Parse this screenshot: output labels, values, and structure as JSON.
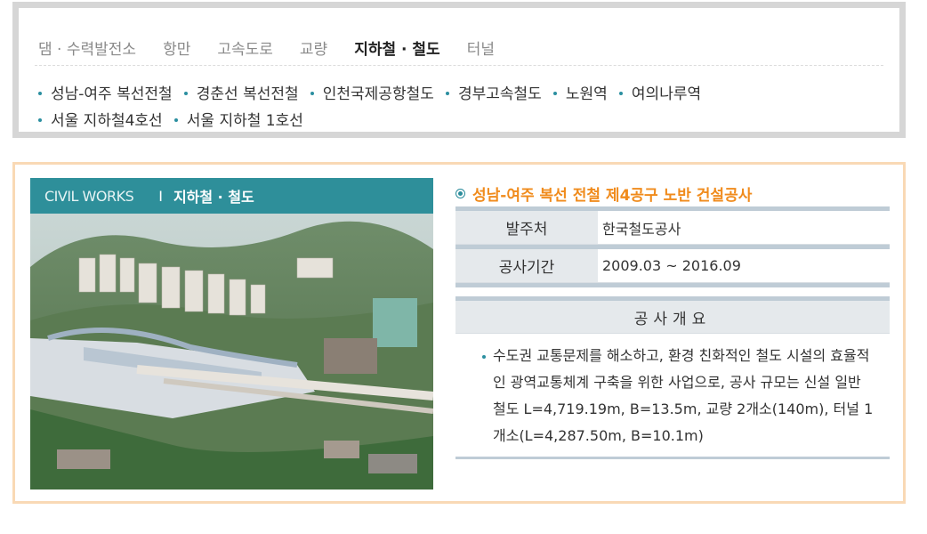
{
  "categories": {
    "tabs": [
      {
        "label": "댐 · 수력발전소",
        "active": false
      },
      {
        "label": "항만",
        "active": false
      },
      {
        "label": "고속도로",
        "active": false
      },
      {
        "label": "교량",
        "active": false
      },
      {
        "label": "지하철 · 철도",
        "active": true
      },
      {
        "label": "터널",
        "active": false
      }
    ],
    "items": [
      "성남-여주 복선전철",
      "경춘선 복선전철",
      "인천국제공항철도",
      "경부고속철도",
      "노원역",
      "여의나루역",
      "서울 지하철4호선",
      "서울 지하철 1호선"
    ]
  },
  "project": {
    "header_brand": "CIVIL WORKS",
    "header_sep": "I",
    "header_category": "지하철 · 철도",
    "title": "성남-여주 복선 전철 제4공구 노반 건설공사",
    "client_label": "발주처",
    "client_value": "한국철도공사",
    "period_label": "공사기간",
    "period_value": "2009.03 ~ 2016.09",
    "summary_label": "공사개요",
    "summary_text": "수도권 교통문제를 해소하고, 환경 친화적인 철도 시설의 효율적인 광역교통체계 구축을 위한 사업으로, 공사 규모는 신설 일반 철도 L=4,719.19m, B=13.5m, 교량 2개소(140m), 터널 1개소(L=4,287.50m, B=10.1m)"
  },
  "colors": {
    "accent_teal": "#2e8f9a",
    "title_orange": "#f08b1c",
    "box_border": "#f9d9b5"
  }
}
